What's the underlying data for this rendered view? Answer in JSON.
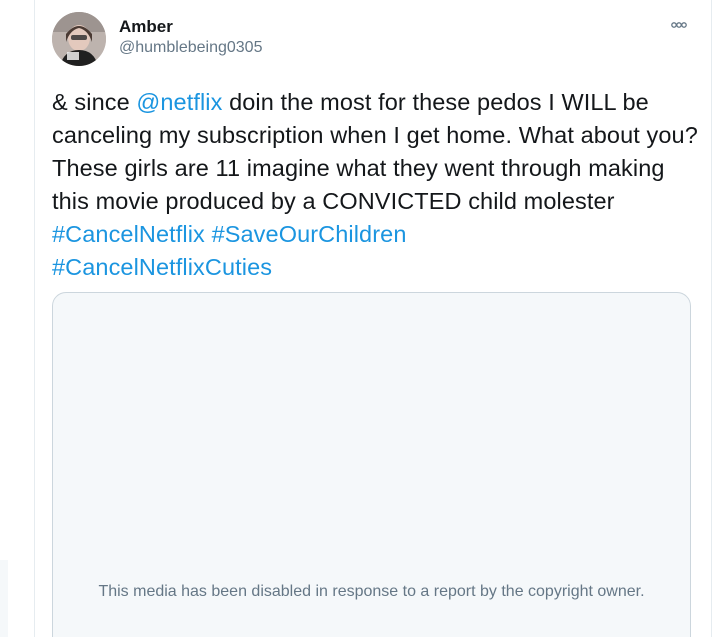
{
  "tweet": {
    "author_name": "Amber",
    "author_handle": "@humblebeing0305",
    "more_icon": "more-horizontal-icon",
    "avatar_icon": "avatar",
    "text": {
      "part1": "& since ",
      "mention": "@netflix",
      "part2": " doin the most for these pedos I WILL be canceling my subscription when I get home. What about you? These girls are 11 imagine what they went through making this movie produced by a CONVICTED child molester ",
      "hashtag1": "#CancelNetflix",
      "space1": " ",
      "hashtag2": "#SaveOurChildren",
      "space2": " ",
      "hashtag3": "#CancelNetflixCuties"
    },
    "media": {
      "disabled_message": "This media has been disabled in response to a report by the copyright owner."
    }
  },
  "colors": {
    "link": "#1b95e0",
    "text": "#14171a",
    "secondary": "#657786",
    "media_bg": "#f5f8fa",
    "border": "#ccd6dd"
  }
}
